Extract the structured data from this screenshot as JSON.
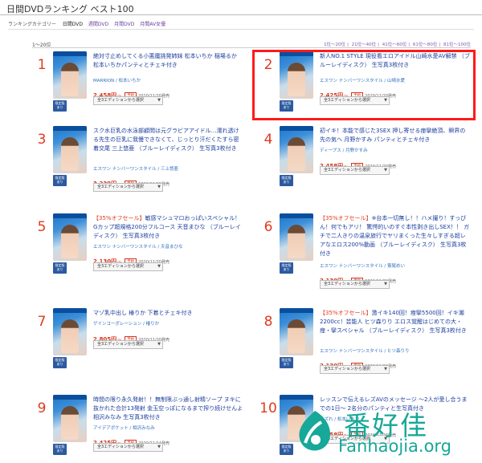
{
  "page": {
    "title": "日間DVDランキング ベスト100"
  },
  "categories": {
    "label": "ランキングカテゴリー",
    "items": [
      "日間DVD",
      "週間DVD",
      "月間DVD",
      "月間AV女優"
    ]
  },
  "list": {
    "range": "1〜20位",
    "pagination": [
      "1位〜20位",
      "21位〜40位",
      "41位〜60位",
      "61位〜80位",
      "81位〜100位"
    ]
  },
  "common": {
    "edition_select": "全3エディションから選択",
    "reserve_badge": "予約",
    "limited_badge_line1": "限定版",
    "limited_badge_line2": "あり",
    "price_suffix": "〜"
  },
  "items": [
    {
      "rank": "1",
      "sale": "",
      "title": "絶対寸止めしてくる小悪魔挑発姉妹 松本いちか 稲場るか 松本いちかパンティとチェキ付き",
      "maker": "MARRION / 松本いちか",
      "price": "2,458円",
      "date": "2020/11/20発売"
    },
    {
      "rank": "2",
      "sale": "",
      "title": "新人NO.1 STYLE 現役看エロアイドル山崎水愛AV解禁 （ブルーレイディスク） 生写真3枚付き",
      "maker": "エスワン ナンバーワンスタイル / 山崎水愛",
      "price": "2,425円",
      "date": "2020/11/20発売"
    },
    {
      "rank": "3",
      "sale": "",
      "title": "スク水巨乳の水泳部顧問は元グラビアアイドル…濡れ透ける先生の巨乳に我慢できなくて、じっとり汗だくたすら密着交尾 三上悠亜 （ブルーレイディスク） 生写真3枚付き",
      "maker": "エスワン ナンバーワンスタイル / 三上悠亜",
      "price": "3,239円",
      "date": "2020/11/20発売"
    },
    {
      "rank": "4",
      "sale": "",
      "title": "初イキ！本能で感じた3SEX 押し寄せる痙攣絶頂、瞬界の先の気へ 月野かすみ パンティとチェキ付き",
      "maker": "ディープス / 月野かすみ",
      "price": "2,458円",
      "date": "2020/11/20発売"
    },
    {
      "rank": "5",
      "sale": "【35%オフセール】",
      "title": "敏感マシュマロおっぱいスペシャル！Gカップ超規格200分フルコース 天音まひな （ブルーレイディスク） 生写真3枚付き",
      "maker": "エスワン ナンバーワンスタイル / 天音まひな",
      "price": "2,130円",
      "date": "2020/11/20発売"
    },
    {
      "rank": "6",
      "sale": "【35%オフセール】",
      "title": "※台本一切無し！！ハメ撮り！すっぴん！何でもアリ！ 驚愕的いのすぐ本性剥き出しSEX！！ ガチで二人きりの温泉旅行でヤリまくった生々しすぎる超レアなエロス200%動画 （ブルーレイディスク） 生写真3枚付き",
      "maker": "エスワン ナンバーワンスタイル / 鷲尾めい",
      "price": "2,130円",
      "date": "2020/11/20発売"
    },
    {
      "rank": "7",
      "sale": "",
      "title": "マゾ乳中出し 椿りか 下着とチェキ付き",
      "maker": "ゲインコーポレーション / 椿りか",
      "price": "2,805円",
      "date": "2020/11/20発売"
    },
    {
      "rank": "8",
      "sale": "【35%オフセール】",
      "title": "激イキ140回！痙攣5500回！イキ潮2200cc！芸能人 ヒツ森りり エロス覚醒はじめての大・痙・攣スペシャル （ブルーレイディスク） 生写真3枚付き",
      "maker": "エスワン ナンバーワンスタイル / ヒツ森りり",
      "price": "2,130円",
      "date": "2020/11/20発売"
    },
    {
      "rank": "9",
      "sale": "",
      "title": "時間の限り永久発射！！無制限ぶっ通し射精ソープ ヌキに抜かれた合計13発射 金玉空っぽになるまで搾り続けせんよ 相沢みなみ 生写真3枚付き",
      "maker": "アイデアポケット / 相沢みなみ",
      "price": "2,425円",
      "date": "2020/11/14発売"
    },
    {
      "rank": "10",
      "sale": "",
      "title": "レッスンで伝えるレズAVのメッセージ ～2人が愛し合うまでの1日～ 2名分のパンティと生写真付き",
      "maker": "レズれ / 松本いちか",
      "price": "2,458円",
      "date": "2020/11/20発売"
    }
  ],
  "watermark": {
    "cn": "番好佳",
    "en": "Fanhaojia.org"
  }
}
